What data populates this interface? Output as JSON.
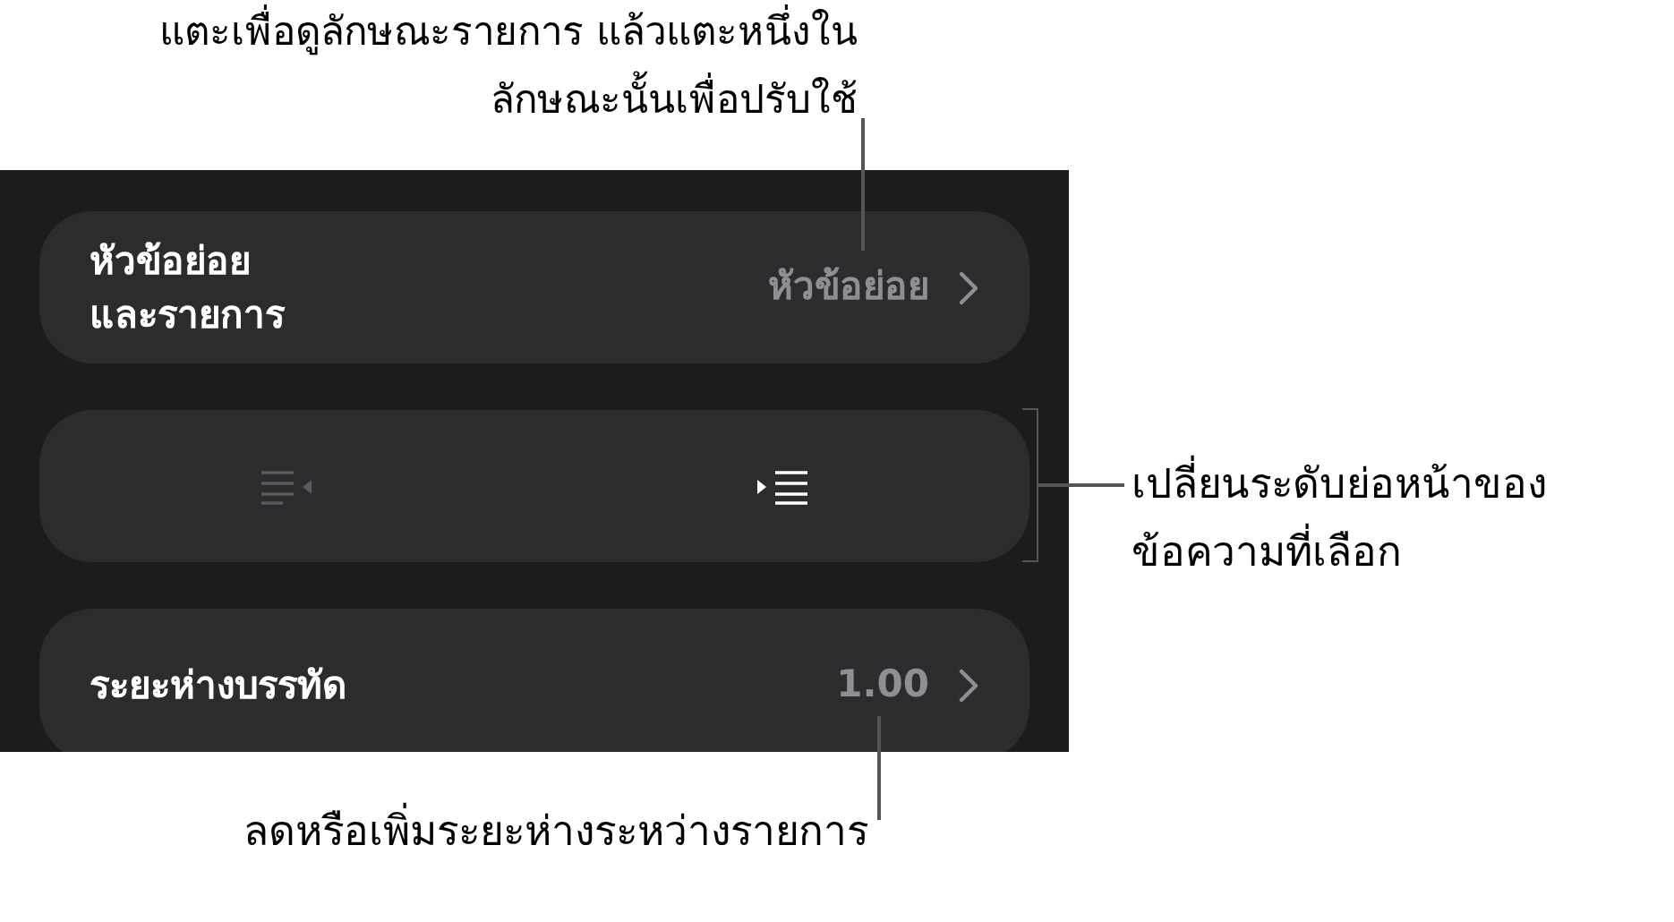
{
  "callouts": [
    {
      "kind": "top",
      "text": "แตะเพื่อดูลักษณะรายการ แล้วแตะหนึ่งใน\nลักษณะนั้นเพื่อปรับใช้"
    },
    {
      "kind": "right",
      "text": "เปลี่ยนระดับย่อหน้าของ\nข้อความที่เลือก"
    },
    {
      "kind": "bottom",
      "text": "ลดหรือเพิ่มระยะห่างระหว่างรายการ"
    }
  ],
  "rows": [
    {
      "kind": "disclosure",
      "label": "หัวข้อย่อย\nและรายการ",
      "value": "หัวข้อย่อย"
    },
    {
      "kind": "indent",
      "buttons": [
        {
          "kind": "outdent",
          "disabled": true
        },
        {
          "kind": "indent",
          "disabled": false
        }
      ]
    },
    {
      "kind": "disclosure",
      "label": "ระยะห่างบรรทัด",
      "value": "1.00"
    }
  ]
}
